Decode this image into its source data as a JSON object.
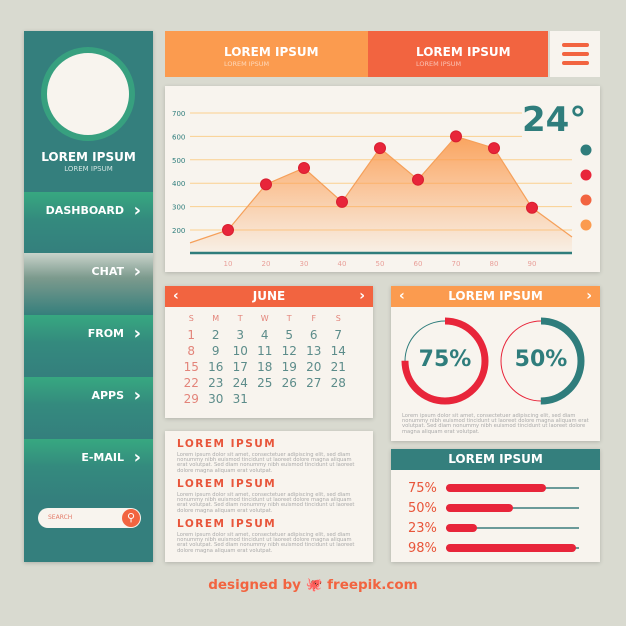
{
  "colors": {
    "teal": "#2f7d7c",
    "green": "#37a07f",
    "orange": "#fb9b4f",
    "red_orange": "#f26440",
    "red": "#e8253a",
    "cream": "#f8f4ee"
  },
  "sidebar": {
    "profile": {
      "name": "LOREM IPSUM",
      "subtitle": "LOREM IPSUM"
    },
    "items": [
      {
        "label": "DASHBOARD",
        "icon": "chevron-right-icon"
      },
      {
        "label": "CHAT",
        "icon": "chevron-right-icon",
        "active": true
      },
      {
        "label": "FROM",
        "icon": "chevron-right-icon"
      },
      {
        "label": "APPS",
        "icon": "chevron-right-icon"
      },
      {
        "label": "E-MAIL",
        "icon": "chevron-right-icon"
      }
    ],
    "search": {
      "placeholder": "SEARCH",
      "icon": "search-icon",
      "chevron": "›",
      "glyph": "⚲"
    }
  },
  "topbar": {
    "tabs": [
      {
        "title": "LOREM IPSUM",
        "subtitle": "LOREM IPSUM"
      },
      {
        "title": "LOREM IPSUM",
        "subtitle": "LOREM IPSUM"
      }
    ],
    "menu_icon": "hamburger-icon"
  },
  "temperature": "24°",
  "legend_colors": [
    "#2f7d7c",
    "#e8253a",
    "#f26440",
    "#fb9b4f"
  ],
  "chart_data": {
    "type": "area",
    "x": [
      10,
      20,
      30,
      40,
      50,
      60,
      70,
      80,
      90
    ],
    "values": [
      200,
      395,
      465,
      320,
      550,
      415,
      600,
      550,
      295
    ],
    "line_start": 145,
    "line_end": 170,
    "y_ticks": [
      200,
      300,
      400,
      500,
      600,
      700
    ],
    "x_ticks": [
      10,
      20,
      30,
      40,
      50,
      60,
      70,
      80,
      90
    ],
    "ylim": [
      100,
      700
    ],
    "xlim": [
      0,
      100
    ],
    "grid": true
  },
  "calendar": {
    "month": "JUNE",
    "prev": "‹",
    "next": "›",
    "days": [
      "S",
      "M",
      "T",
      "W",
      "T",
      "F",
      "S"
    ],
    "weeks": [
      [
        "1",
        "2",
        "3",
        "4",
        "5",
        "6",
        "7"
      ],
      [
        "8",
        "9",
        "10",
        "11",
        "12",
        "13",
        "14"
      ],
      [
        "15",
        "16",
        "17",
        "18",
        "19",
        "20",
        "21"
      ],
      [
        "22",
        "23",
        "24",
        "25",
        "26",
        "27",
        "28"
      ],
      [
        "29",
        "30",
        "31",
        "",
        "",
        "",
        ""
      ]
    ]
  },
  "articles": [
    {
      "title": "LOREM IPSUM",
      "body": "Lorem ipsum dolor sit amet, consectetuer adipiscing elit, sed diam nonummy nibh euismod tincidunt ut laoreet dolore magna aliquam erat volutpat. Sed diam nonummy nibh euismod tincidunt ut laoreet dolore magna aliquam erat volutpat."
    },
    {
      "title": "LOREM IPSUM",
      "body": "Lorem ipsum dolor sit amet, consectetuer adipiscing elit, sed diam nonummy nibh euismod tincidunt ut laoreet dolore magna aliquam erat volutpat. Sed diam nonummy nibh euismod tincidunt ut laoreet dolore magna aliquam erat volutpat."
    },
    {
      "title": "LOREM IPSUM",
      "body": "Lorem ipsum dolor sit amet, consectetuer adipiscing elit, sed diam nonummy nibh euismod tincidunt ut laoreet dolore magna aliquam erat volutpat. Sed diam nonummy nibh euismod tincidunt ut laoreet dolore magna aliquam erat volutpat."
    }
  ],
  "donut_panel": {
    "title": "LOREM IPSUM",
    "prev": "‹",
    "next": "›",
    "donuts": [
      {
        "label": "75%",
        "value": 0.75,
        "color": "#e8253a",
        "track": "#2f7d7c"
      },
      {
        "label": "50%",
        "value": 0.5,
        "color": "#2f7d7c",
        "track": "#e8253a"
      }
    ],
    "text": "Lorem ipsum dolor sit amet, consectetuer adipiscing elit, sed diam nonummy nibh euismod tincidunt ut laoreet dolore magna aliquam erat volutpat. Sed diam nonummy nibh euismod tincidunt ut laoreet dolore magna aliquam erat volutpat."
  },
  "bar_panel": {
    "title": "LOREM IPSUM",
    "bars": [
      {
        "label": "75%",
        "value": 0.75
      },
      {
        "label": "50%",
        "value": 0.5
      },
      {
        "label": "23%",
        "value": 0.23
      },
      {
        "label": "98%",
        "value": 0.98
      }
    ]
  },
  "credit": "designed by 🐙 freepik.com"
}
